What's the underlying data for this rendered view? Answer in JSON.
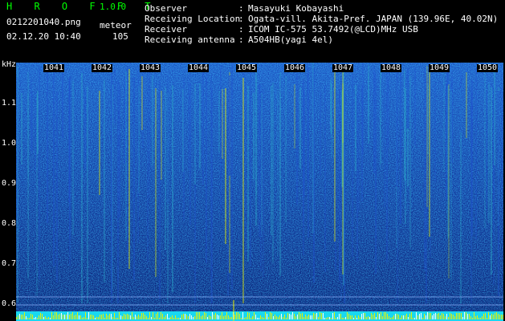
{
  "header": {
    "app_title": "H R O F F T",
    "app_version": "1.0.0",
    "filename": "0212201040.png",
    "kind": "meteor",
    "datetime": "02.12.20 10:40",
    "count": "105"
  },
  "info": [
    {
      "label": "Observer",
      "sep": ":",
      "value": "Masayuki Kobayashi"
    },
    {
      "label": "Receiving Location",
      "sep": ":",
      "value": "Ogata-vill. Akita-Pref. JAPAN (139.96E, 40.02N)"
    },
    {
      "label": "Receiver",
      "sep": ":",
      "value": "ICOM IC-575 53.7492(@LCD)MHz USB"
    },
    {
      "label": "Receiving antenna",
      "sep": ":",
      "value": "A504HB(yagi 4el)"
    }
  ],
  "spectrogram": {
    "y_unit": "kHz",
    "y_ticks": [
      "1.1",
      "1.0",
      "0.9",
      "0.8",
      "0.7",
      "0.6"
    ],
    "x_ticks": [
      "1041",
      "1042",
      "1043",
      "1044",
      "1045",
      "1046",
      "1047",
      "1048",
      "1049",
      "1050"
    ],
    "colors": {
      "noise_dark": "#0a1a6e",
      "noise_mid": "#1e4fd0",
      "noise_bright": "#2aa6c8",
      "signal": "#e8f000",
      "strip": "#19d8f0"
    }
  }
}
